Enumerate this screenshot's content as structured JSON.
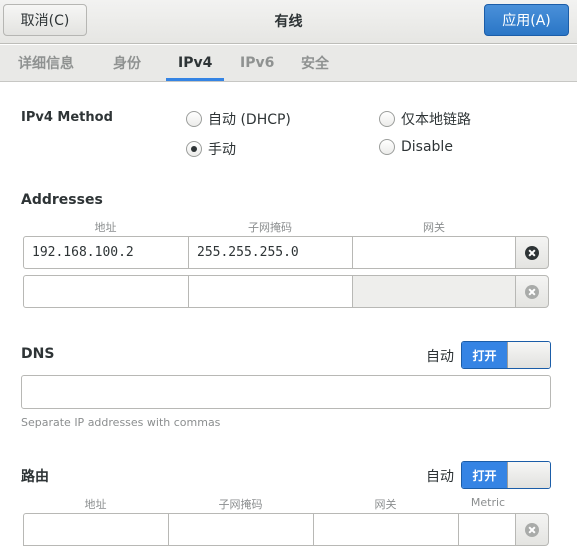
{
  "header": {
    "title": "有线",
    "cancel_label": "取消(C)",
    "apply_label": "应用(A)"
  },
  "tabs": [
    {
      "label": "详细信息"
    },
    {
      "label": "身份"
    },
    {
      "label": "IPv4",
      "active": true
    },
    {
      "label": "IPv6"
    },
    {
      "label": "安全"
    }
  ],
  "ipv4_method": {
    "label": "IPv4 Method",
    "options": [
      {
        "label": "自动 (DHCP)",
        "checked": false
      },
      {
        "label": "仅本地链路",
        "checked": false
      },
      {
        "label": "手动",
        "checked": true
      },
      {
        "label": "Disable",
        "checked": false
      }
    ]
  },
  "addresses": {
    "title": "Addresses",
    "columns": [
      "地址",
      "子网掩码",
      "网关"
    ],
    "rows": [
      {
        "address": "192.168.100.2",
        "netmask": "255.255.255.0",
        "gateway": ""
      },
      {
        "address": "",
        "netmask": "",
        "gateway": ""
      }
    ]
  },
  "dns": {
    "title": "DNS",
    "auto_label": "自动",
    "switch_label": "打开",
    "switch_on": true,
    "value": "",
    "hint": "Separate IP addresses with commas"
  },
  "routes": {
    "title": "路由",
    "auto_label": "自动",
    "switch_label": "打开",
    "switch_on": true,
    "columns": [
      "地址",
      "子网掩码",
      "网关",
      "Metric"
    ]
  },
  "colors": {
    "accent": "#3584e4",
    "apply_button": "#2a76c6"
  }
}
